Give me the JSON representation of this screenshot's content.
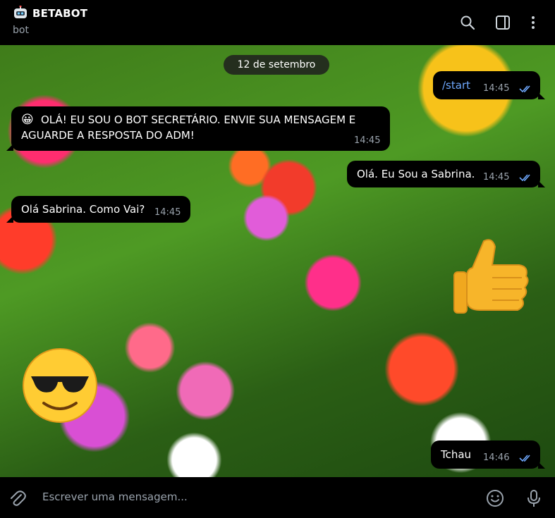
{
  "header": {
    "title": "BETABOT",
    "subtitle": "bot",
    "icons": [
      "search-icon",
      "sidebar-toggle-icon",
      "more-vertical-icon"
    ]
  },
  "chat": {
    "date_pill": "12 de setembro",
    "messages": [
      {
        "direction": "out",
        "text": "/start",
        "time": "14:45",
        "status": "read"
      },
      {
        "direction": "in",
        "emoji": "😀",
        "lines": [
          "OLÁ! EU SOU O BOT SECRETÁRIO. ENVIE SUA MENSAGEM E",
          "AGUARDE A RESPOSTA DO ADM!"
        ],
        "time": "14:45"
      },
      {
        "direction": "out",
        "text": "Olá. Eu Sou a Sabrina.",
        "time": "14:45",
        "status": "read"
      },
      {
        "direction": "in",
        "text": "Olá Sabrina. Como Vai?",
        "time": "14:45"
      },
      {
        "direction": "in",
        "sticker": "thumbs-up"
      },
      {
        "direction": "out",
        "sticker": "sunglasses-face"
      },
      {
        "direction": "out",
        "text": "Tchau",
        "time": "14:46",
        "status": "read"
      }
    ],
    "accent_color": "#6ea8fe",
    "background": "flower-field"
  },
  "composer": {
    "placeholder": "Escrever uma mensagem...",
    "icons": [
      "attach-icon",
      "emoji-icon",
      "microphone-icon"
    ]
  }
}
